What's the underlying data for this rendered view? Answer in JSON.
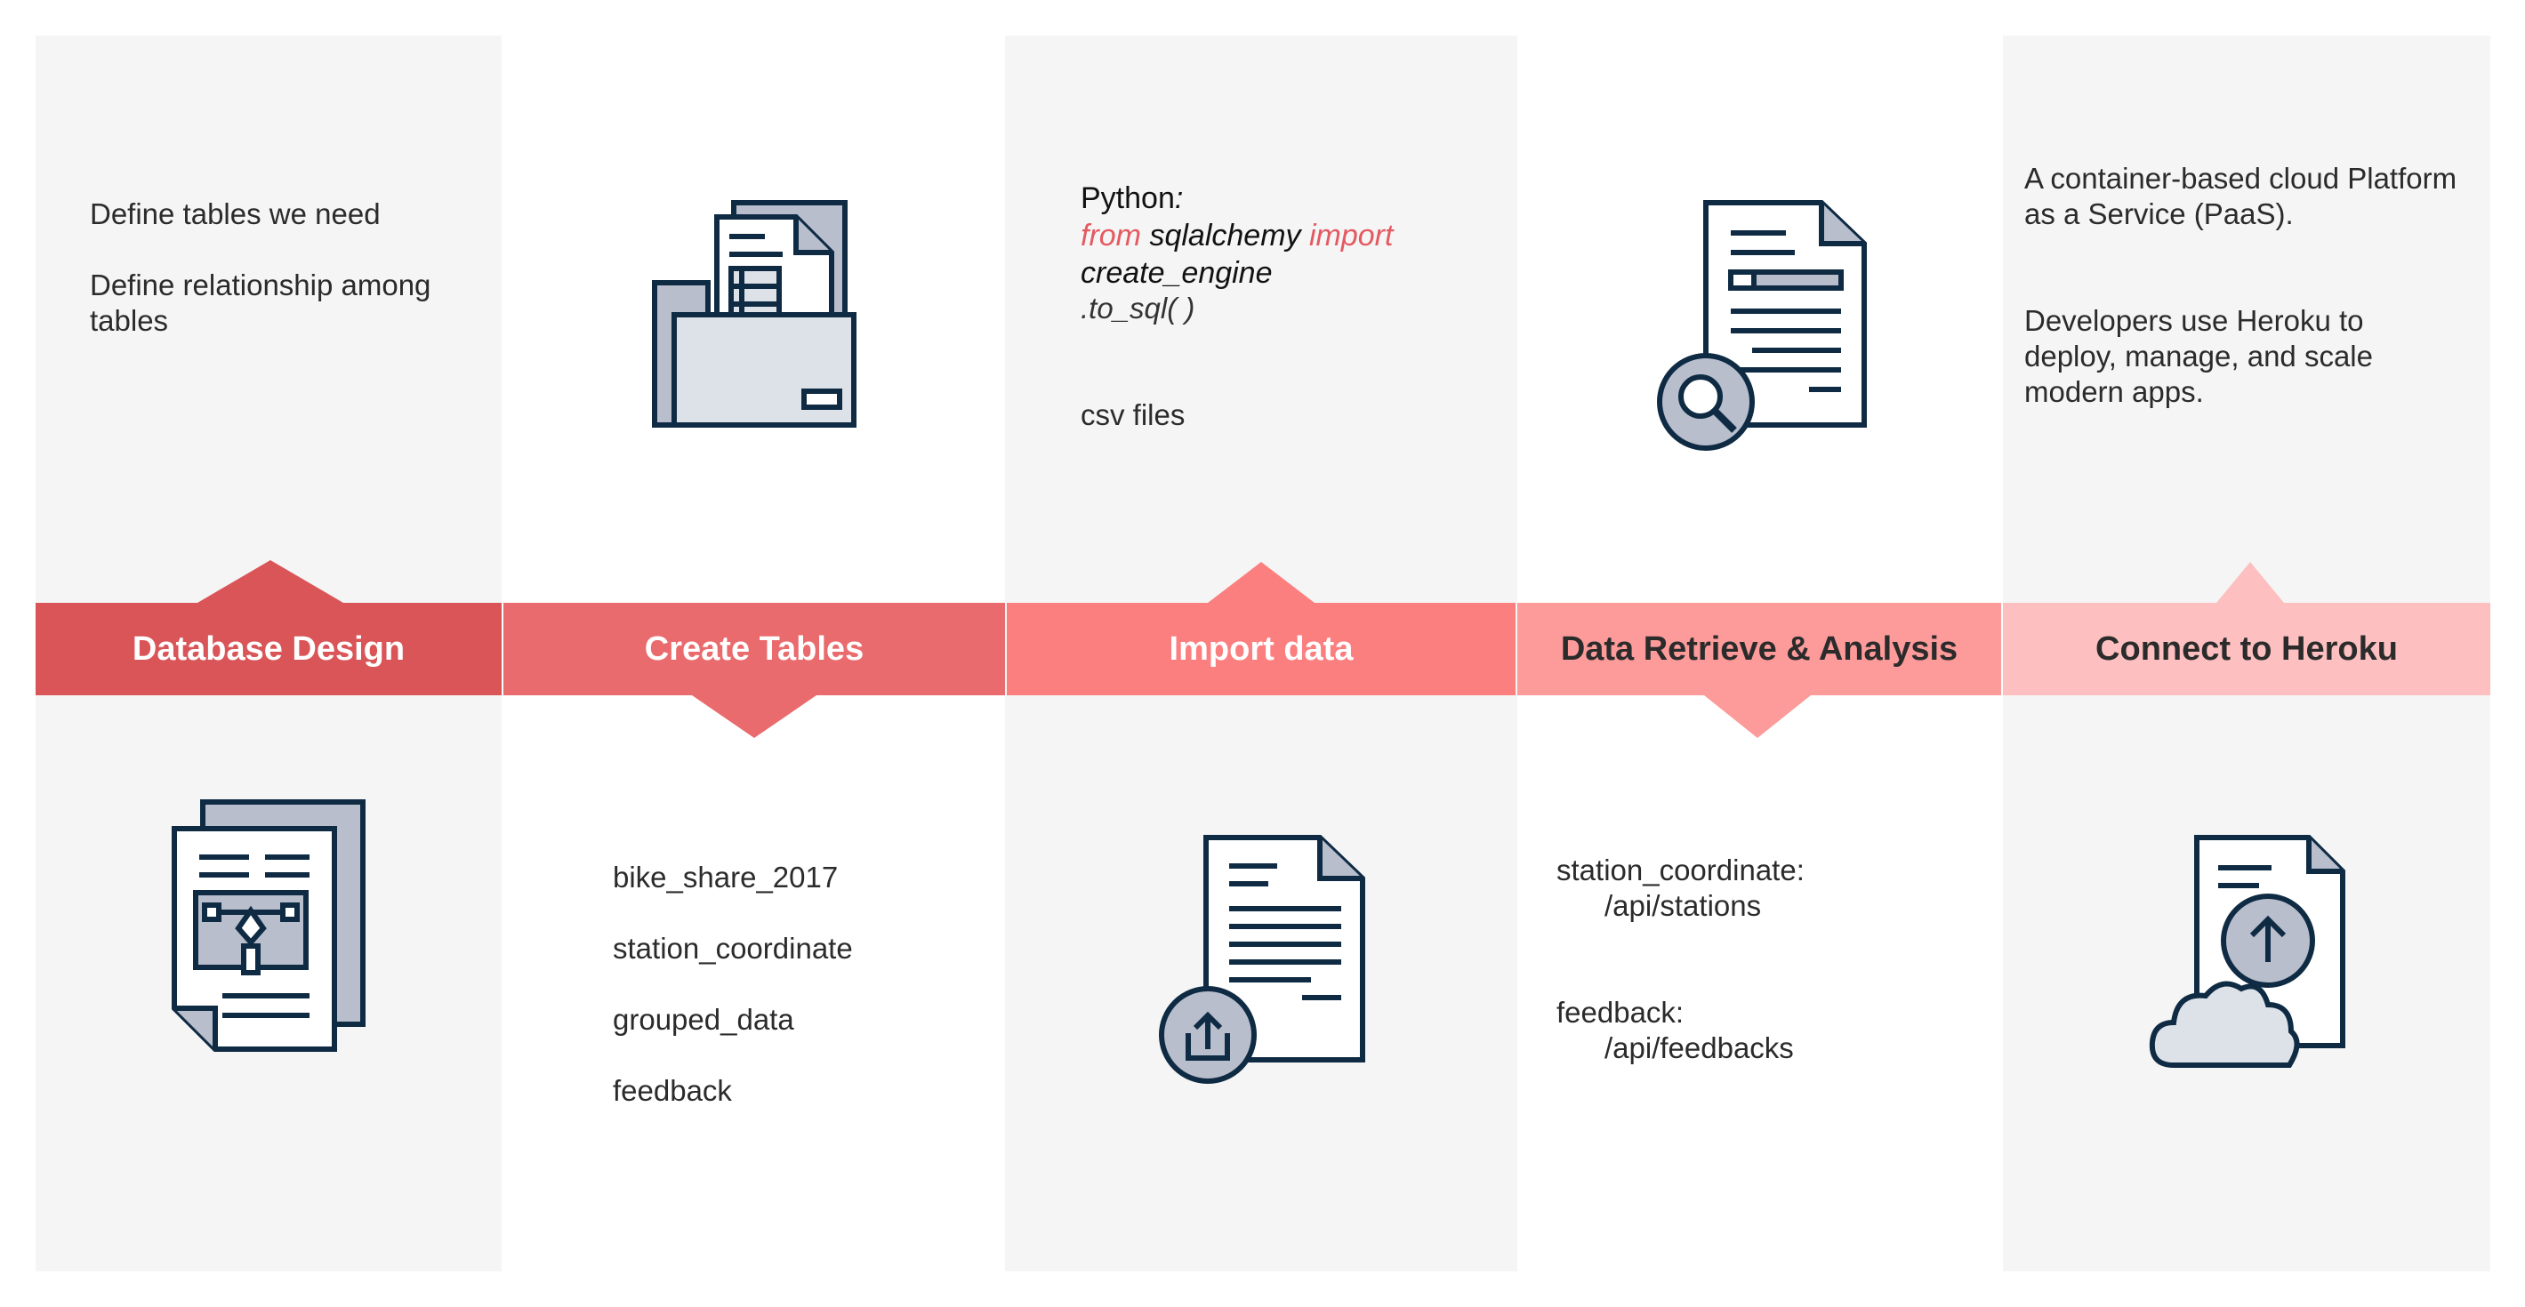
{
  "stages": [
    {
      "label": "Database Design",
      "color": "#d95558",
      "text_color": "#ffffff",
      "notes": [
        "Define tables we need",
        "Define relationship among",
        "tables"
      ]
    },
    {
      "label": "Create Tables",
      "color": "#ea6b6d",
      "text_color": "#ffffff",
      "notes": [
        "bike_share_2017",
        "station_coordinate",
        "grouped_data",
        "feedback"
      ]
    },
    {
      "label": "Import data",
      "color": "#fc7f80",
      "text_color": "#ffffff",
      "notes": {
        "python_label": "Python",
        "python_colon": ":",
        "kw_from": "from",
        "module": "sqlalchemy",
        "kw_import": "import",
        "func": "create_engine",
        "method": ".to_sql( )",
        "csv": "csv files"
      }
    },
    {
      "label": "Data Retrieve & Analysis",
      "color": "#fd9a9a",
      "text_color": "#2b2b2b",
      "notes": [
        "station_coordinate:",
        "/api/stations",
        "feedback:",
        "/api/feedbacks"
      ]
    },
    {
      "label": "Connect to Heroku",
      "color": "#fdbfbf",
      "text_color": "#2b2b2b",
      "notes": [
        "A container-based cloud Platform",
        "as a Service (PaaS).",
        "Developers use Heroku to",
        "deploy, manage, and scale",
        "modern apps."
      ]
    }
  ],
  "colors": {
    "panel": "#f5f5f5",
    "icon_stroke": "#0f2b44",
    "icon_fill": "#b8becc",
    "icon_light": "#dde1e8",
    "keyword": "#e45a62"
  },
  "icons": [
    "file-cabinet-icon",
    "document-search-icon",
    "document-design-icon",
    "document-upload-icon",
    "cloud-upload-icon"
  ]
}
